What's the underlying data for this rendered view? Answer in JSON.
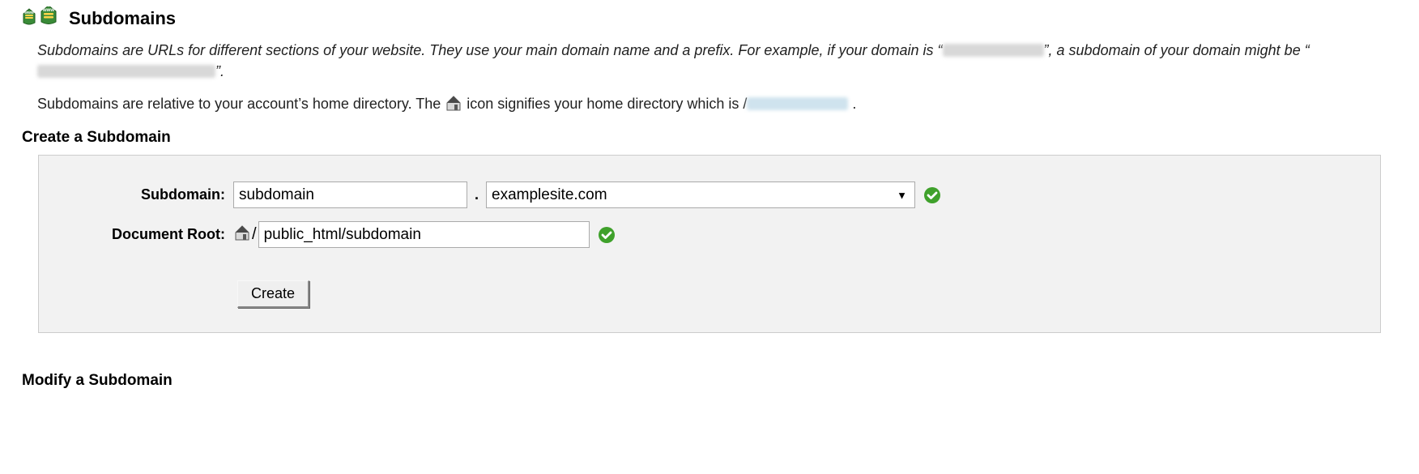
{
  "header": {
    "title": "Subdomains"
  },
  "intro": {
    "line1a": "Subdomains are URLs for different sections of your website. They use your main domain name and a prefix. For example, if your domain is “",
    "line1b": "”, a subdomain of your domain might be “",
    "line1c": "”.",
    "line2a": "Subdomains are relative to your account’s home directory. The ",
    "line2b": " icon signifies your home directory which is /",
    "line2c": " ."
  },
  "create": {
    "heading": "Create a Subdomain",
    "subdomain_label": "Subdomain:",
    "subdomain_value": "subdomain",
    "domain_selected": "examplesite.com",
    "docroot_label": "Document Root:",
    "docroot_value": "public_html/subdomain",
    "create_button": "Create"
  },
  "modify": {
    "heading": "Modify a Subdomain"
  }
}
